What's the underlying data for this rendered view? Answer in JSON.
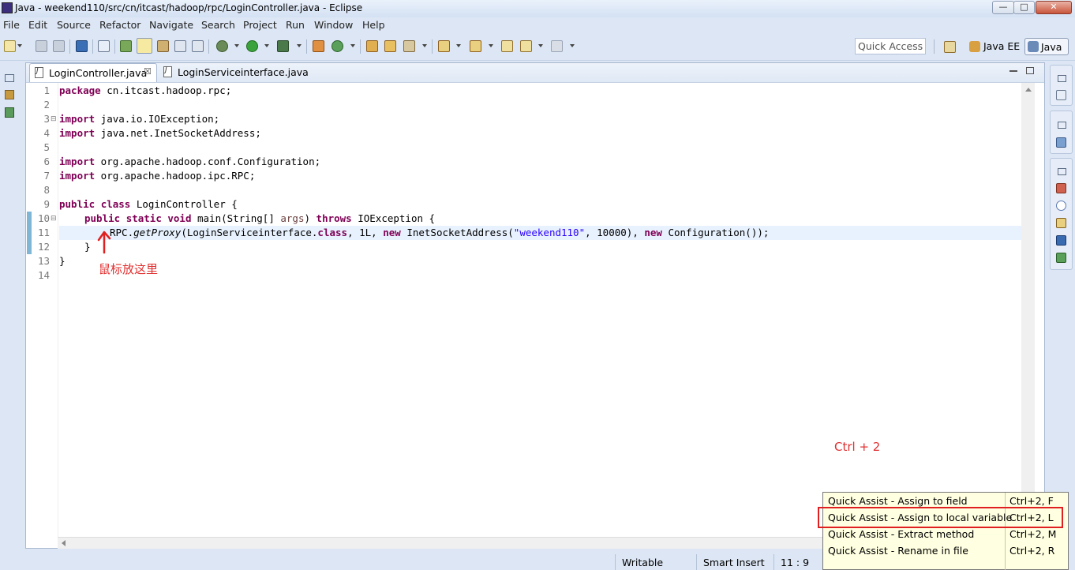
{
  "window": {
    "title": "Java - weekend110/src/cn/itcast/hadoop/rpc/LoginController.java - Eclipse",
    "controls": {
      "minimize": "—",
      "maximize": "□",
      "close": "✕"
    }
  },
  "menu": [
    "File",
    "Edit",
    "Source",
    "Refactor",
    "Navigate",
    "Search",
    "Project",
    "Run",
    "Window",
    "Help"
  ],
  "toolbar": {
    "quick_access": "Quick Access",
    "perspectives": [
      "Java EE",
      "Java"
    ]
  },
  "editor": {
    "tabs": [
      {
        "label": "LoginController.java",
        "active": true,
        "close": "☒"
      },
      {
        "label": "LoginServiceinterface.java",
        "active": false
      }
    ],
    "lines": [
      {
        "n": "1"
      },
      {
        "n": "2"
      },
      {
        "n": "3"
      },
      {
        "n": "4"
      },
      {
        "n": "5"
      },
      {
        "n": "6"
      },
      {
        "n": "7"
      },
      {
        "n": "8"
      },
      {
        "n": "9"
      },
      {
        "n": "10"
      },
      {
        "n": "11"
      },
      {
        "n": "12"
      },
      {
        "n": "13"
      },
      {
        "n": "14"
      }
    ],
    "code": {
      "kw_package": "package",
      "pkg": " cn.itcast.hadoop.rpc;",
      "kw_import": "import",
      "imp1": " java.io.IOException;",
      "imp2": " java.net.InetSocketAddress;",
      "imp3": " org.apache.hadoop.conf.Configuration;",
      "imp4": " org.apache.hadoop.ipc.RPC;",
      "kw_public": "public",
      "kw_class": "class",
      "class_name": " LoginController {",
      "kw_static": "static",
      "kw_void": "void",
      "main_sig": " main(String[] ",
      "param": "args",
      "close_paren": ") ",
      "kw_throws": "throws",
      "throws_tail": " IOException {",
      "call_rpc": "RPC.",
      "call_method": "getProxy",
      "call_arg1": "(LoginServiceinterface.",
      "kw_class_lit": "class",
      "call_arg2": ", 1L, ",
      "kw_new": "new",
      "call_arg3": " InetSocketAddress(",
      "call_str": "\"weekend110\"",
      "call_arg4": ", 10000), ",
      "call_arg5": " Configuration());",
      "brace_inner": "}",
      "brace_outer": "}",
      "fold_marker": "⊟"
    }
  },
  "annotations": {
    "mouse_here": "鼠标放这里",
    "shortcut": "Ctrl  + 2"
  },
  "quick_assist": {
    "items": [
      {
        "label": "Quick Assist - Assign to field",
        "key": "Ctrl+2, F"
      },
      {
        "label": "Quick Assist - Assign to local variable",
        "key": "Ctrl+2, L",
        "highlighted": true
      },
      {
        "label": "Quick Assist - Extract method",
        "key": "Ctrl+2, M"
      },
      {
        "label": "Quick Assist - Rename in file",
        "key": "Ctrl+2, R"
      }
    ]
  },
  "status": {
    "writable": "Writable",
    "insert_mode": "Smart Insert",
    "position": "11 : 9"
  },
  "colors": {
    "keyword": "#7f0055",
    "string": "#2a00ff",
    "annotation": "#e03030",
    "popup_bg": "#ffffe1"
  }
}
